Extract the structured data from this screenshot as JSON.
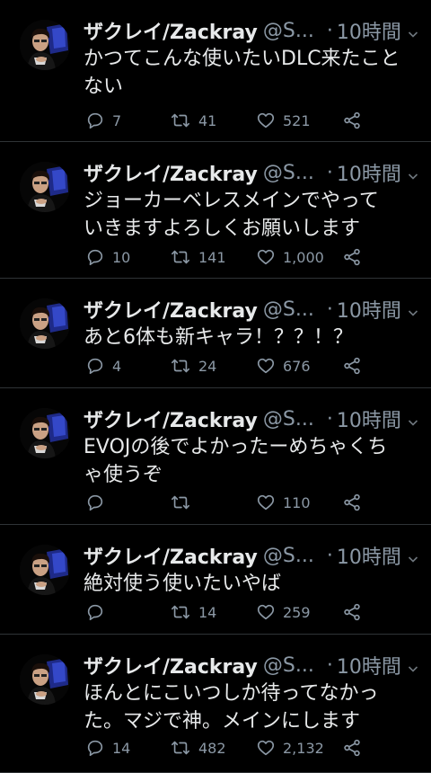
{
  "tweets": [
    {
      "name": "ザクレイ/Zackray",
      "handle": "@S...",
      "dot": "·",
      "time": "10時間",
      "lines": [
        "かつてこんな使いたいDLC来たこと",
        "ない"
      ],
      "replies": "7",
      "retweets": "41",
      "likes": "521"
    },
    {
      "name": "ザクレイ/Zackray",
      "handle": "@S...",
      "dot": "·",
      "time": "10時間",
      "lines": [
        "ジョーカーベレスメインでやって",
        "いきますよろしくお願いします"
      ],
      "replies": "10",
      "retweets": "141",
      "likes": "1,000"
    },
    {
      "name": "ザクレイ/Zackray",
      "handle": "@S...",
      "dot": "·",
      "time": "10時間",
      "lines": [
        "あと6体も新キャラ！？？！？"
      ],
      "replies": "4",
      "retweets": "24",
      "likes": "676"
    },
    {
      "name": "ザクレイ/Zackray",
      "handle": "@S...",
      "dot": "·",
      "time": "10時間",
      "lines": [
        "EVOJの後でよかったーめちゃくち",
        "ゃ使うぞ"
      ],
      "replies": "",
      "retweets": "",
      "likes": "110"
    },
    {
      "name": "ザクレイ/Zackray",
      "handle": "@S...",
      "dot": "·",
      "time": "10時間",
      "lines": [
        "絶対使う使いたいやば"
      ],
      "replies": "",
      "retweets": "14",
      "likes": "259"
    },
    {
      "name": "ザクレイ/Zackray",
      "handle": "@S...",
      "dot": "·",
      "time": "10時間",
      "lines": [
        "ほんとにこいつしか待ってなかっ",
        "た。マジで神。メインにします"
      ],
      "replies": "14",
      "retweets": "482",
      "likes": "2,132"
    }
  ],
  "icons": {
    "reply": "reply-icon",
    "retweet": "retweet-icon",
    "like": "heart-icon",
    "share": "share-icon",
    "menu": "chevron-down-icon"
  },
  "colors": {
    "background": "#000000",
    "text": "#e7e9ea",
    "secondary": "#8b98a5",
    "divider": "#2f3336"
  }
}
